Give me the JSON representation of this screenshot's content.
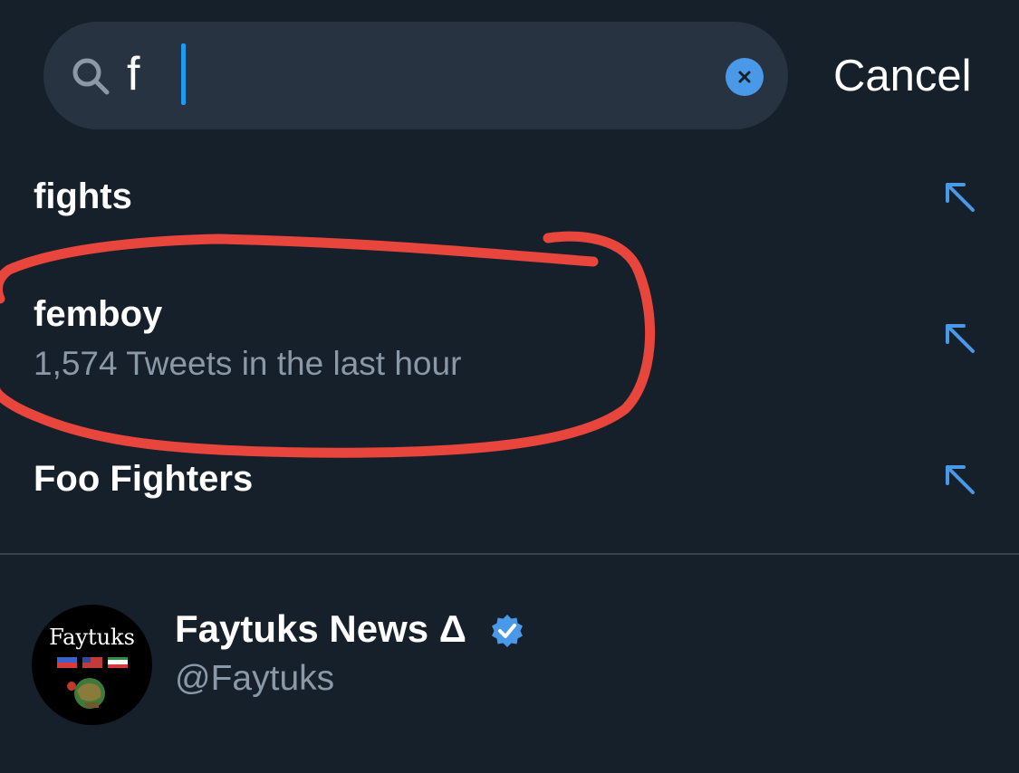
{
  "search": {
    "query": "f",
    "clear_icon": "x-circle-icon",
    "search_icon": "search-icon"
  },
  "cancel_label": "Cancel",
  "suggestions": [
    {
      "label": "fights",
      "subtitle": "",
      "icon": "arrow-up-left-icon"
    },
    {
      "label": "femboy",
      "subtitle": "1,574 Tweets in the last hour",
      "icon": "arrow-up-left-icon"
    },
    {
      "label": "Foo Fighters",
      "subtitle": "",
      "icon": "arrow-up-left-icon"
    }
  ],
  "account": {
    "name": "Faytuks News Δ",
    "handle": "@Faytuks",
    "avatar_text": "Faytuks",
    "verified": true
  },
  "colors": {
    "background": "#15202b",
    "search_field": "#273340",
    "accent": "#1d9bf0",
    "secondary_text": "#8b98a5",
    "annotation": "#e8453c"
  }
}
